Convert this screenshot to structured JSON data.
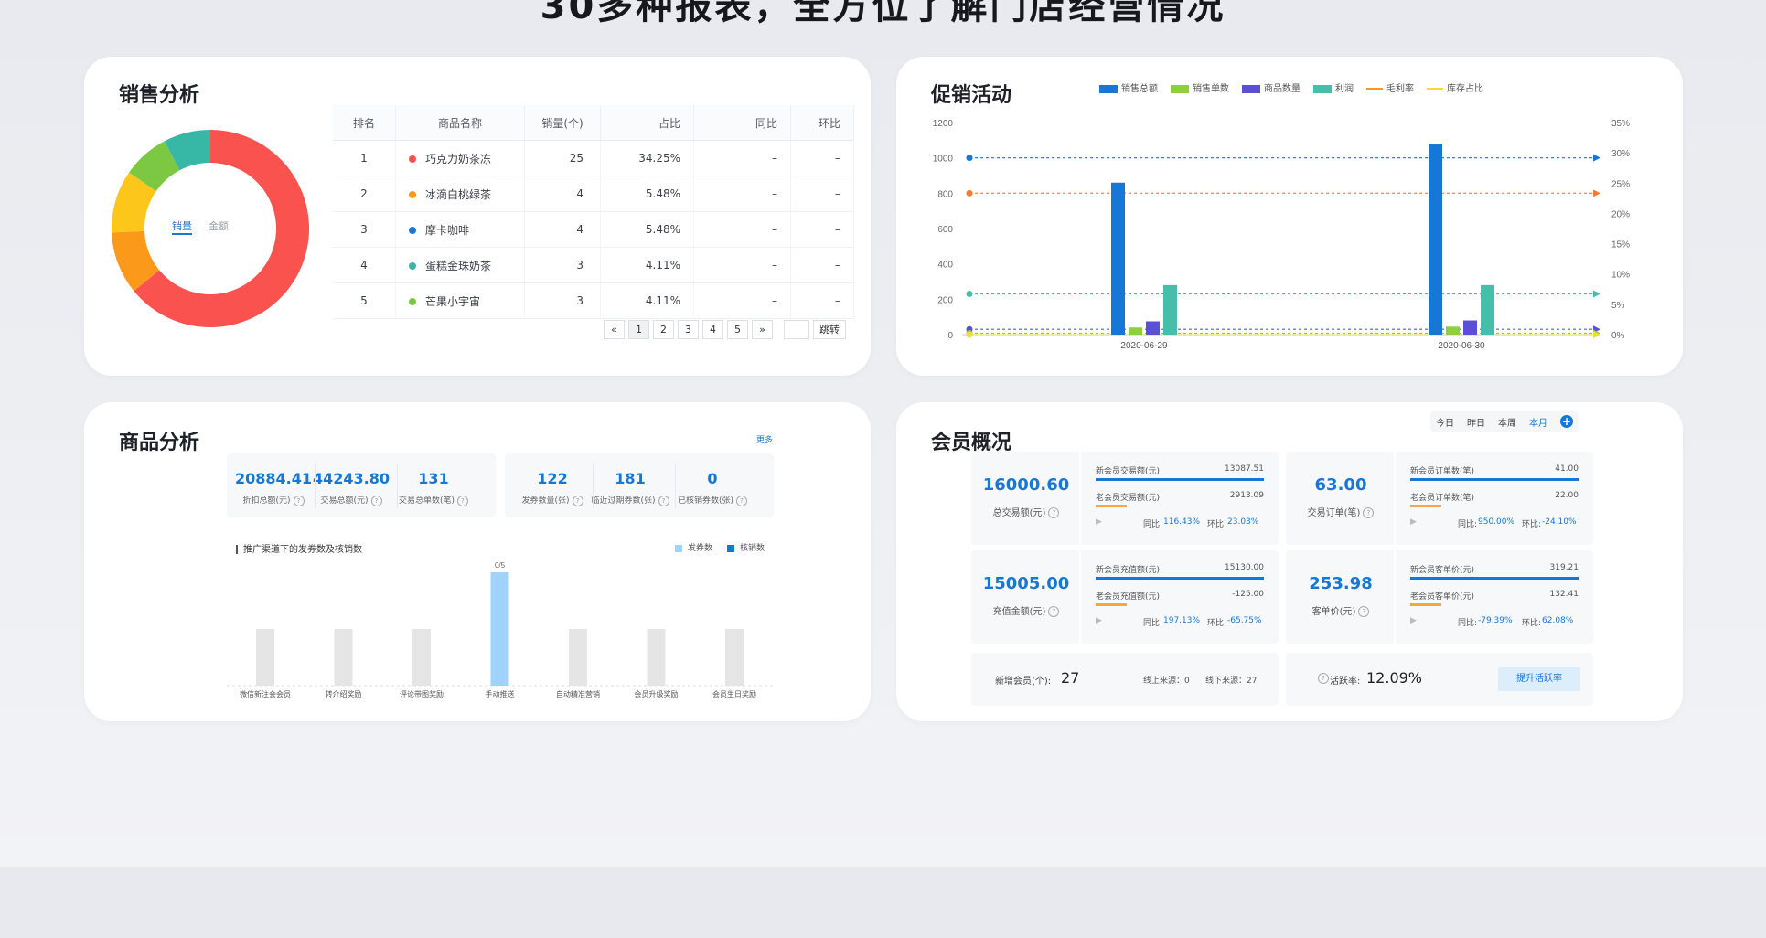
{
  "hero_title": "30多种报表，全方位了解门店经营情况",
  "sales": {
    "title": "销售分析",
    "donut_tabs": [
      "销量",
      "金额"
    ],
    "donut_slices": [
      {
        "name": "巧克力奶茶冻",
        "value": 25,
        "color": "#f9524f"
      },
      {
        "name": "冰滴白桃绿茶",
        "value": 4,
        "color": "#fb9a1a"
      },
      {
        "name": "摩卡咖啡",
        "value": 4,
        "color": "#fcc61a"
      },
      {
        "name": "蛋糕金珠奶茶",
        "value": 3,
        "color": "#7dc842"
      },
      {
        "name": "芒果小宇宙",
        "value": 3,
        "color": "#37b7a5"
      }
    ],
    "table_headers": [
      "排名",
      "商品名称",
      "销量(个)",
      "占比",
      "同比",
      "环比"
    ],
    "rows": [
      {
        "rank": "1",
        "name": "巧克力奶茶冻",
        "qty": "25",
        "pct": "34.25%",
        "yoy": "–",
        "mom": "–",
        "color": "#f9524f"
      },
      {
        "rank": "2",
        "name": "冰滴白桃绿茶",
        "qty": "4",
        "pct": "5.48%",
        "yoy": "–",
        "mom": "–",
        "color": "#fb9a1a"
      },
      {
        "rank": "3",
        "name": "摩卡咖啡",
        "qty": "4",
        "pct": "5.48%",
        "yoy": "–",
        "mom": "–",
        "color": "#1677d6"
      },
      {
        "rank": "4",
        "name": "蛋糕金珠奶茶",
        "qty": "3",
        "pct": "4.11%",
        "yoy": "–",
        "mom": "–",
        "color": "#37b7a5"
      },
      {
        "rank": "5",
        "name": "芒果小宇宙",
        "qty": "3",
        "pct": "4.11%",
        "yoy": "–",
        "mom": "–",
        "color": "#7dc842"
      }
    ],
    "pager": {
      "prev": "«",
      "pages": [
        "1",
        "2",
        "3",
        "4",
        "5"
      ],
      "next": "»",
      "jump": "跳转"
    }
  },
  "promo": {
    "title": "促销活动",
    "legend": [
      "销售总额",
      "销售单数",
      "商品数量",
      "利润",
      "毛利率",
      "库存占比"
    ]
  },
  "product": {
    "title": "商品分析",
    "more": "更多",
    "stats_left": [
      {
        "value": "20884.41",
        "label": "折扣总额(元)"
      },
      {
        "value": "44243.80",
        "label": "交易总额(元)"
      },
      {
        "value": "131",
        "label": "交易总单数(笔)"
      }
    ],
    "stats_right": [
      {
        "value": "122",
        "label": "发券数量(张)"
      },
      {
        "value": "181",
        "label": "临近过期券数(张)"
      },
      {
        "value": "0",
        "label": "已核销券数(张)"
      }
    ],
    "chart_title": "推广渠道下的发券数及核销数",
    "legend": [
      "发券数",
      "核销数"
    ]
  },
  "member": {
    "title": "会员概况",
    "tabs": [
      "今日",
      "昨日",
      "本周",
      "本月"
    ],
    "boxes": [
      {
        "value": "16000.60",
        "label": "总交易额(元)",
        "r1_label": "新会员交易额(元)",
        "r1_value": "13087.51",
        "r2_label": "老会员交易额(元)",
        "r2_value": "2913.09",
        "yoy_label": "同比:",
        "yoy": "116.43%",
        "mom_label": "环比:",
        "mom": "23.03%"
      },
      {
        "value": "63.00",
        "label": "交易订单(笔)",
        "r1_label": "新会员订单数(笔)",
        "r1_value": "41.00",
        "r2_label": "老会员订单数(笔)",
        "r2_value": "22.00",
        "yoy_label": "同比:",
        "yoy": "950.00%",
        "mom_label": "环比:",
        "mom": "-24.10%"
      },
      {
        "value": "15005.00",
        "label": "充值金额(元)",
        "r1_label": "新会员充值额(元)",
        "r1_value": "15130.00",
        "r2_label": "老会员充值额(元)",
        "r2_value": "-125.00",
        "yoy_label": "同比:",
        "yoy": "197.13%",
        "mom_label": "环比:",
        "mom": "-65.75%"
      },
      {
        "value": "253.98",
        "label": "客单价(元)",
        "r1_label": "新会员客单价(元)",
        "r1_value": "319.21",
        "r2_label": "老会员客单价(元)",
        "r2_value": "132.41",
        "yoy_label": "同比:",
        "yoy": "-79.39%",
        "mom_label": "环比:",
        "mom": "62.08%"
      }
    ],
    "new_members_label": "新增会员(个):",
    "new_members_value": "27",
    "online_source": "线上来源：0",
    "offline_source": "线下来源：27",
    "active_label": "活跃率:",
    "active_value": "12.09%",
    "boost_button": "提升活跃率"
  },
  "colors": {
    "blue": "#1677d6",
    "green": "#8fcf3c",
    "purple": "#5b4fd6",
    "teal": "#45bfa9",
    "orange": "#fb7a2e",
    "yellow": "#f5d83a",
    "light_blue": "#9fd3fb",
    "grey_bar": "#e5e5e5"
  },
  "chart_data": [
    {
      "type": "bar",
      "title": "",
      "categories": [
        "2020-06-29",
        "2020-06-30"
      ],
      "series": [
        {
          "name": "销售总额",
          "values": [
            860,
            1080
          ]
        },
        {
          "name": "销售单数",
          "values": [
            40,
            45
          ]
        },
        {
          "name": "商品数量",
          "values": [
            75,
            80
          ]
        },
        {
          "name": "利润",
          "values": [
            280,
            280
          ]
        }
      ],
      "line_series": [
        {
          "name": "毛利率",
          "values": [
            25,
            25
          ]
        },
        {
          "name": "库存占比",
          "values": [
            0,
            0
          ]
        }
      ],
      "ylim": [
        0,
        1200
      ],
      "y_ticks": [
        0,
        200,
        400,
        600,
        800,
        1000,
        1200
      ],
      "y2lim": [
        0,
        35
      ],
      "y2_ticks": [
        "0%",
        "5%",
        "10%",
        "15%",
        "20%",
        "25%",
        "30%",
        "35%"
      ],
      "legend_position": "top"
    },
    {
      "type": "bar",
      "title": "推广渠道下的发券数及核销数",
      "categories": [
        "微信新注会会员",
        "转介绍奖励",
        "评论带图奖励",
        "手动推送",
        "自动精准营销",
        "会员升级奖励",
        "会员生日奖励"
      ],
      "series": [
        {
          "name": "发券数",
          "values": [
            0.2,
            0.2,
            0.2,
            0.4,
            0.2,
            0.2,
            0.2
          ]
        },
        {
          "name": "核销数",
          "values": [
            0,
            0,
            0,
            0,
            0,
            0,
            0
          ]
        }
      ],
      "highlight_label": "0/5",
      "ylim": [
        0,
        0.4
      ],
      "legend_position": "top-right"
    }
  ]
}
